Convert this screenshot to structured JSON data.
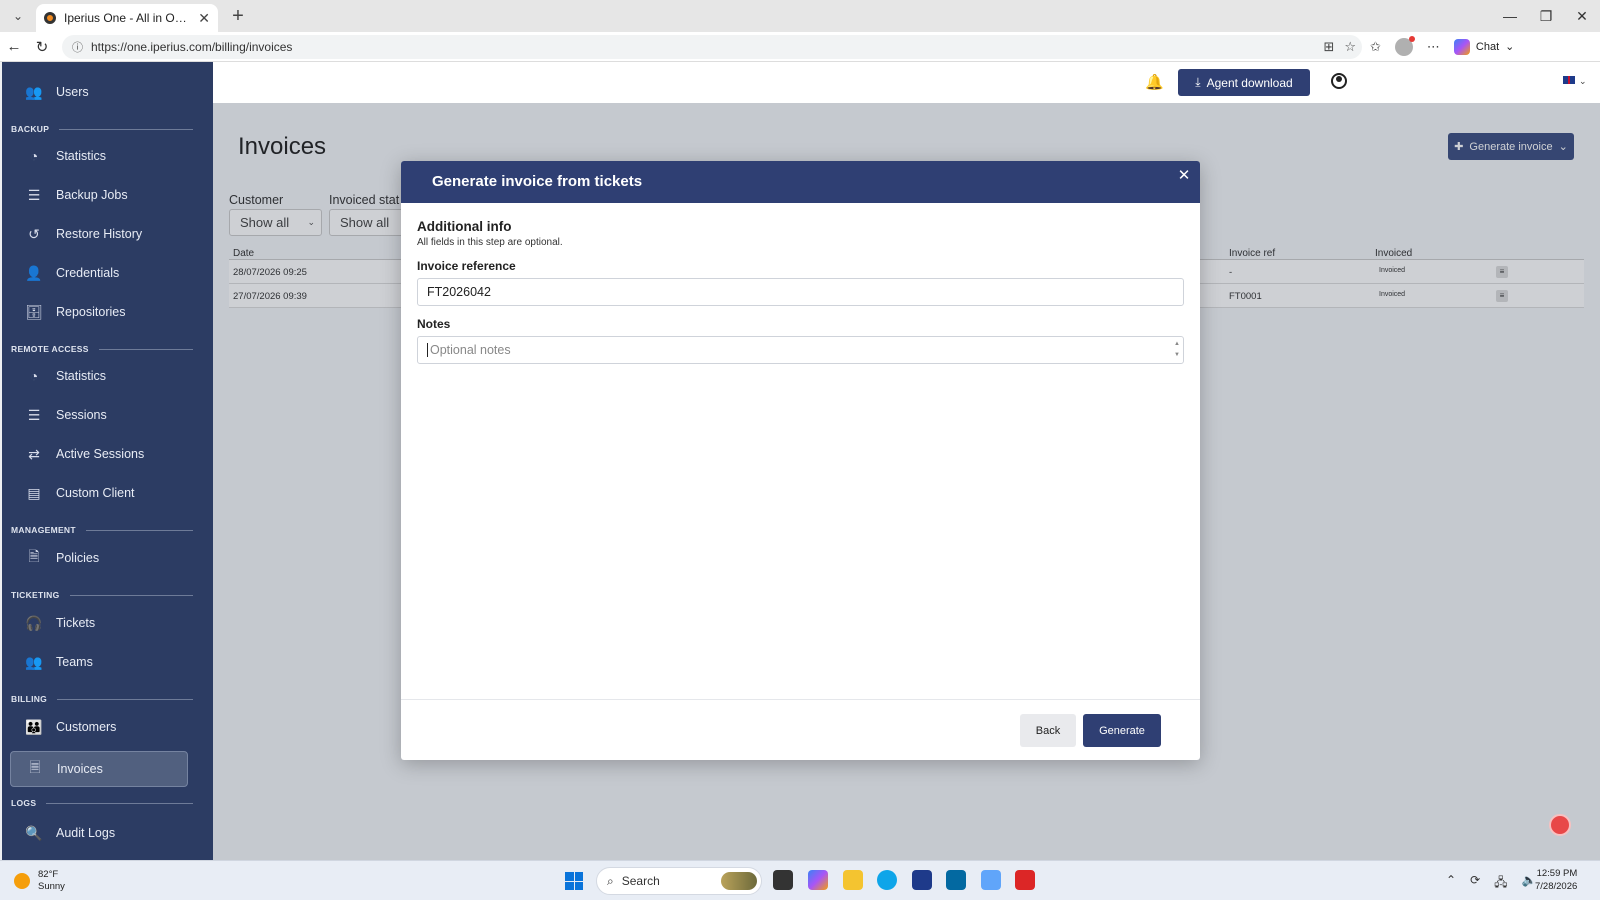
{
  "browser": {
    "tab_title": "Iperius One - All in One RMM Suite",
    "url": "https://one.iperius.com/billing/invoices",
    "chat_label": "Chat"
  },
  "sidebar": {
    "items": [
      {
        "label": "Users",
        "icon": "users-icon"
      },
      {
        "section": "BACKUP"
      },
      {
        "label": "Statistics",
        "icon": "pie-chart-icon"
      },
      {
        "label": "Backup Jobs",
        "icon": "list-icon"
      },
      {
        "label": "Restore History",
        "icon": "history-icon"
      },
      {
        "label": "Credentials",
        "icon": "user-lock-icon"
      },
      {
        "label": "Repositories",
        "icon": "repository-icon"
      },
      {
        "section": "REMOTE ACCESS"
      },
      {
        "label": "Statistics",
        "icon": "pie-chart-icon"
      },
      {
        "label": "Sessions",
        "icon": "list-icon"
      },
      {
        "label": "Active Sessions",
        "icon": "arrows-icon"
      },
      {
        "label": "Custom Client",
        "icon": "window-icon"
      },
      {
        "section": "MANAGEMENT"
      },
      {
        "label": "Policies",
        "icon": "document-icon"
      },
      {
        "section": "TICKETING"
      },
      {
        "label": "Tickets",
        "icon": "headset-icon"
      },
      {
        "label": "Teams",
        "icon": "team-icon"
      },
      {
        "section": "BILLING"
      },
      {
        "label": "Customers",
        "icon": "customers-icon"
      },
      {
        "label": "Invoices",
        "icon": "invoice-icon",
        "active": true
      },
      {
        "section": "LOGS"
      },
      {
        "label": "Audit Logs",
        "icon": "search-doc-icon"
      }
    ]
  },
  "header": {
    "agent_download": "Agent download"
  },
  "page": {
    "title": "Invoices",
    "generate_invoice": "Generate invoice",
    "filters": {
      "customer_label": "Customer",
      "customer_value": "Show all",
      "invoiced_label": "Invoiced stat",
      "invoiced_value": "Show all"
    },
    "table": {
      "headers": {
        "date": "Date",
        "invoice_ref": "Invoice ref",
        "invoiced": "Invoiced"
      },
      "rows": [
        {
          "date": "28/07/2026 09:25",
          "invoice_ref": "-",
          "invoiced": "Invoiced"
        },
        {
          "date": "27/07/2026 09:39",
          "invoice_ref": "FT0001",
          "invoiced": "Invoiced"
        }
      ]
    }
  },
  "modal": {
    "title": "Generate invoice from tickets",
    "step_title": "Additional info",
    "step_subtitle": "All fields in this step are optional.",
    "invoice_reference_label": "Invoice reference",
    "invoice_reference_value": "FT2026042",
    "notes_label": "Notes",
    "notes_placeholder": "Optional notes",
    "back_label": "Back",
    "generate_label": "Generate"
  },
  "taskbar": {
    "temperature": "82°F",
    "weather": "Sunny",
    "search": "Search",
    "time": "12:59 PM",
    "date": "7/28/2026"
  }
}
